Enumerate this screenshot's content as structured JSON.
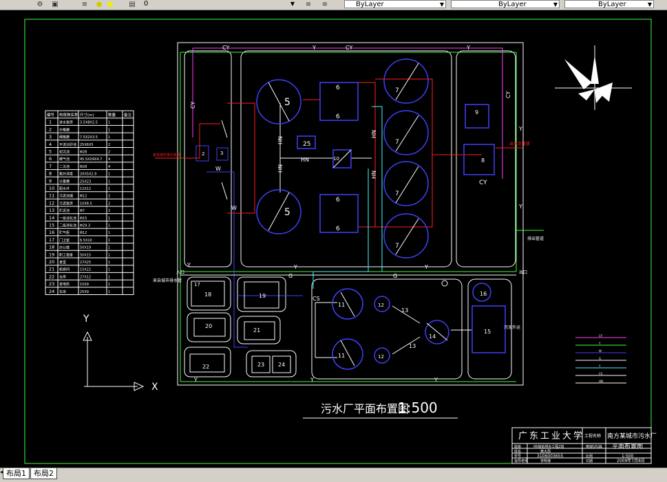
{
  "toolbar": {
    "layer_value": "0",
    "color_value": "ByLayer",
    "linetype_value": "ByLayer",
    "lineweight_value": "ByLayer"
  },
  "tabs": {
    "items": [
      "布局1",
      "布局2"
    ]
  },
  "drawing": {
    "title": "污水厂平面布置图",
    "scale": "1:500",
    "axis_x": "X",
    "axis_y": "Y",
    "inflow_label": "来自城市排水管网",
    "outflow_right": "出水至排放",
    "sludge_out": "污泥外运",
    "discharge_label": "排出管道",
    "left_inflow2": "来自城市排水管",
    "gate_left": "入口",
    "gate_right": "出口"
  },
  "legend_table": {
    "headers": [
      "编号",
      "构筑物名称",
      "尺寸(m)",
      "数量",
      "备注"
    ],
    "rows": [
      [
        "1",
        "进水泵房",
        "3.5X8X2.5",
        "1"
      ],
      [
        "2",
        "中格栅",
        "",
        "1"
      ],
      [
        "3",
        "细格栅",
        "7.5X2X3.5",
        "1"
      ],
      [
        "4",
        "平流沉砂池",
        "25X6X5",
        "2"
      ],
      [
        "5",
        "初沉池",
        "Φ28",
        "2"
      ],
      [
        "6",
        "曝气池",
        "45.5X24X4.7",
        "4"
      ],
      [
        "7",
        "二沉池",
        "Φ28",
        "4"
      ],
      [
        "8",
        "紫外消毒",
        "20X5X2.9",
        "1"
      ],
      [
        "9",
        "计量槽",
        "25X23",
        "1"
      ],
      [
        "10",
        "配水井",
        "12X12",
        "1"
      ],
      [
        "11",
        "污泥浓缩",
        "Φ12",
        "2"
      ],
      [
        "12",
        "污泥泵房",
        "10X8.5",
        "2"
      ],
      [
        "13",
        "贮泥池",
        "Φ7",
        "2"
      ],
      [
        "14",
        "一级消化池",
        "Φ15",
        "1"
      ],
      [
        "15",
        "二级消化池",
        "Φ29.3",
        "1"
      ],
      [
        "16",
        "贮气柜",
        "Φ12",
        "1"
      ],
      [
        "17",
        "门卫室",
        "6.5X10",
        "1"
      ],
      [
        "18",
        "办公楼",
        "50X19",
        "1"
      ],
      [
        "19",
        "职工宿舍",
        "50X15",
        "1"
      ],
      [
        "20",
        "食堂",
        "27X25",
        "1"
      ],
      [
        "21",
        "机修间",
        "15X22",
        "1"
      ],
      [
        "22",
        "仓库",
        "27X12",
        "1"
      ],
      [
        "23",
        "变电所",
        "15X9",
        "1"
      ],
      [
        "24",
        "车库",
        "25X9",
        "1"
      ]
    ]
  },
  "title_block": {
    "school": "广东工业大学",
    "project_label": "工程名称",
    "project_name": "南方某城市污水厂",
    "class_label": "班级",
    "class_value": "06级给排水工程2班",
    "name_label": "姓名",
    "name_value": "黄大周",
    "id_label": "学号",
    "id_value": "3106003655",
    "content_label": "图纸内容",
    "content_value": "平面布置图",
    "teacher_label": "指导老师",
    "teacher_value": "李明博",
    "scale_label": "比例",
    "scale_value": "1:500",
    "date_label": "日期",
    "date_value": "2009年7月8日"
  },
  "pipe_legend": [
    {
      "label": "CY",
      "color": "#ff40ff"
    },
    {
      "label": "Y",
      "color": "#40ff40"
    },
    {
      "label": "W",
      "color": "#4040ff"
    },
    {
      "label": "G",
      "color": "#ffffff"
    },
    {
      "label": "Y",
      "color": "#40ffff"
    },
    {
      "label": "CS",
      "color": "#ffffff"
    },
    {
      "label": "HN",
      "color": "#ffffff"
    }
  ],
  "units": {
    "primary_clarifier": "5",
    "aeration": "6",
    "secondary": "7",
    "dist_well": "10",
    "uv": "8",
    "meter": "9",
    "grit": "25",
    "thickener": "11",
    "sludge_pump": "12",
    "storage": "13",
    "digester1": "14",
    "digester2": "15",
    "gas": "16",
    "guard": "17",
    "office": "18",
    "dorm": "19",
    "canteen": "20",
    "repair": "21",
    "warehouse": "22",
    "substation": "23",
    "garage": "24",
    "pump": "1",
    "coarse": "2",
    "fine": "3",
    "hn": "HN",
    "pipe_cy": "CY",
    "pipe_y": "Y",
    "pipe_w": "W",
    "pipe_g": "G",
    "pipe_cs": "CS"
  }
}
